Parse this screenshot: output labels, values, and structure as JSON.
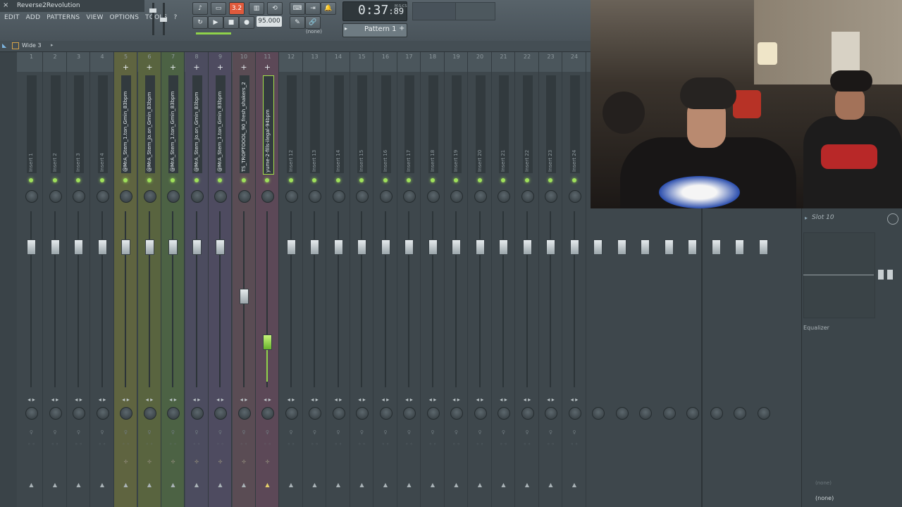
{
  "app": {
    "title": "Reverse2Revolution",
    "close_glyph": "×",
    "menus": [
      "EDIT",
      "ADD",
      "PATTERNS",
      "VIEW",
      "OPTIONS",
      "TOOLS",
      "?"
    ]
  },
  "transport": {
    "time": "0:37",
    "time_fraction": "89",
    "time_unit": "M:S:CS",
    "tempo": "95.000",
    "pattern": "Pattern 1",
    "record_display": "3.2",
    "snap": "(none)"
  },
  "mixer": {
    "preset": "Wide 3",
    "tracks": [
      {
        "num": "1",
        "name": "Insert 1",
        "color": "",
        "fader": 0
      },
      {
        "num": "2",
        "name": "Insert 2",
        "color": "",
        "fader": 0
      },
      {
        "num": "3",
        "name": "Insert 3",
        "color": "",
        "fader": 0
      },
      {
        "num": "4",
        "name": "Insert 4",
        "color": "",
        "fader": 0
      },
      {
        "num": "5",
        "name": "@MrA_Stem_1.ton_Gmin_83bpm",
        "color": "#5f6440",
        "fader": 0
      },
      {
        "num": "6",
        "name": "@MrA_Stem_Jo.on_Gmin_83bpm",
        "color": "#59643f",
        "fader": 0
      },
      {
        "num": "7",
        "name": "@MrA_Stem_1.ton_Gmin_83bpm",
        "color": "#4c6244",
        "fader": 0
      },
      {
        "num": "8",
        "name": "@MrA_Stem_Jo.on_Gmin_83bpm",
        "color": "#4c4c5f",
        "fader": 0
      },
      {
        "num": "9",
        "name": "@MrA_Stem_1.ton_Gmin_83bpm",
        "color": "#4e4b60",
        "fader": 0
      },
      {
        "num": "10",
        "name": "TS_TROPTOOOL_90_fresh_shakers_2",
        "color": "#5a4c54",
        "fader": 1
      },
      {
        "num": "11",
        "name": "yume-2-fills-ilegal-94bpm",
        "color": "#5c4857",
        "fader": 2
      },
      {
        "num": "12",
        "name": "Insert 12",
        "color": "",
        "fader": 0
      },
      {
        "num": "13",
        "name": "Insert 13",
        "color": "",
        "fader": 0
      },
      {
        "num": "14",
        "name": "Insert 14",
        "color": "",
        "fader": 0
      },
      {
        "num": "15",
        "name": "Insert 15",
        "color": "",
        "fader": 0
      },
      {
        "num": "16",
        "name": "Insert 16",
        "color": "",
        "fader": 0
      },
      {
        "num": "17",
        "name": "Insert 17",
        "color": "",
        "fader": 0
      },
      {
        "num": "18",
        "name": "Insert 18",
        "color": "",
        "fader": 0
      },
      {
        "num": "19",
        "name": "Insert 19",
        "color": "",
        "fader": 0
      },
      {
        "num": "20",
        "name": "Insert 20",
        "color": "",
        "fader": 0
      },
      {
        "num": "21",
        "name": "Insert 21",
        "color": "",
        "fader": 0
      },
      {
        "num": "22",
        "name": "Insert 22",
        "color": "",
        "fader": 0
      },
      {
        "num": "23",
        "name": "Insert 23",
        "color": "",
        "fader": 0
      },
      {
        "num": "24",
        "name": "Insert 24",
        "color": "",
        "fader": 0
      }
    ]
  },
  "fx_panel": {
    "slot_label": "Slot 10",
    "eq_label": "Equalizer",
    "route_mid": "(none)",
    "route_bottom": "(none)"
  }
}
